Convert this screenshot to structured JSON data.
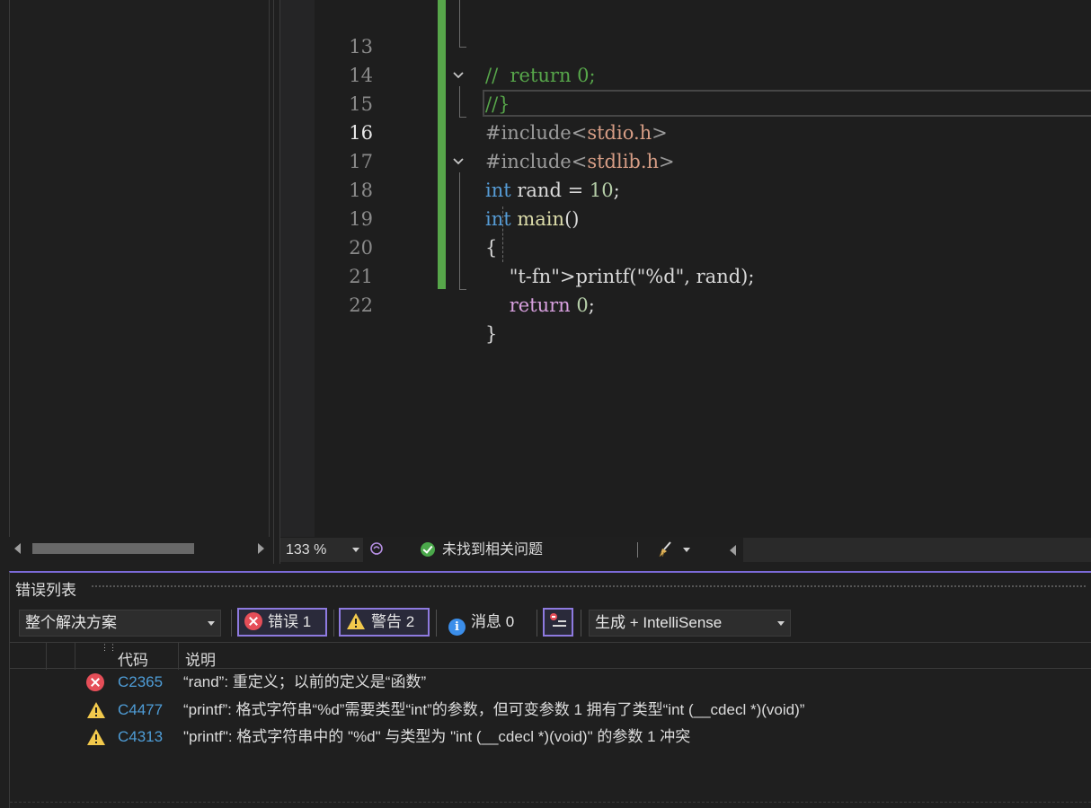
{
  "editor": {
    "lines": [
      {
        "number": "13",
        "text": "//  return 0;"
      },
      {
        "number": "14",
        "text": "//}"
      },
      {
        "number": "15",
        "text": "#include<stdio.h>"
      },
      {
        "number": "16",
        "text": "#include<stdlib.h>"
      },
      {
        "number": "17",
        "text": "int rand = 10;"
      },
      {
        "number": "18",
        "text": "int main()"
      },
      {
        "number": "19",
        "text": "{"
      },
      {
        "number": "20",
        "text": "    printf(\"%d\", rand);"
      },
      {
        "number": "21",
        "text": "    return 0;"
      },
      {
        "number": "22",
        "text": "}"
      }
    ],
    "current_line": "16",
    "zoom": "133 %",
    "issues_status": "未找到相关问题"
  },
  "error_list": {
    "title": "错误列表",
    "scope": "整个解决方案",
    "filters": {
      "errors": "错误 1",
      "warnings": "警告 2",
      "messages": "消息 0"
    },
    "source": "生成 + IntelliSense",
    "columns": {
      "code": "代码",
      "description": "说明"
    },
    "rows": [
      {
        "severity": "error",
        "code": "C2365",
        "description": "“rand”: 重定义；以前的定义是“函数”"
      },
      {
        "severity": "warning",
        "code": "C4477",
        "description": "“printf”: 格式字符串“%d”需要类型“int”的参数，但可变参数 1 拥有了类型“int (__cdecl *)(void)”"
      },
      {
        "severity": "warning",
        "code": "C4313",
        "description": "\"printf\": 格式字符串中的 \"%d\" 与类型为 \"int (__cdecl *)(void)\" 的参数 1 冲突"
      }
    ]
  },
  "colors": {
    "accent": "#8e7ae0",
    "change_bar": "#57a64a",
    "error": "#e54e58",
    "warning": "#f2c94c",
    "info": "#3b8eea"
  },
  "icons": [
    "fold-chevron-icon",
    "intellicode-icon",
    "check-circle-icon",
    "broom-icon",
    "error-icon",
    "warning-icon",
    "info-icon",
    "filter-icon"
  ]
}
